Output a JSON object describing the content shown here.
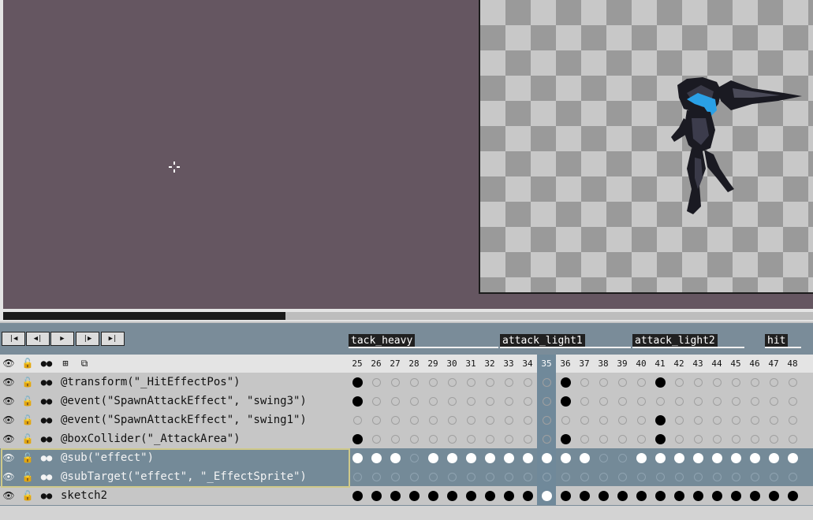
{
  "colors": {
    "canvas_bg": "#655661",
    "timeline_header": "#7a8c99",
    "row_light": "#c6c6c6",
    "row_header": "#e4e4e4",
    "row_selected": "#748a98",
    "row_selected_border": "#cfc98a",
    "current_frame_col": "#70899a",
    "cel_filled": "#000000",
    "cel_selected": "#ffffff"
  },
  "playback": {
    "buttons": [
      {
        "icon": "first-frame-icon",
        "glyph": "|◀"
      },
      {
        "icon": "previous-frame-icon",
        "glyph": "◀|"
      },
      {
        "icon": "play-icon",
        "glyph": "▶"
      },
      {
        "icon": "next-frame-icon",
        "glyph": "|▶"
      },
      {
        "icon": "last-frame-icon",
        "glyph": "▶|"
      }
    ]
  },
  "tags": [
    {
      "label": "tack_heavy",
      "from": 25,
      "to": 32
    },
    {
      "label": "attack_light1",
      "from": 33,
      "to": 39
    },
    {
      "label": "attack_light2",
      "from": 40,
      "to": 45
    },
    {
      "label": "hit",
      "from": 47,
      "to": 48
    }
  ],
  "layer_header": {
    "icons": [
      "eye-icon",
      "lock-icon",
      "continuous-icon",
      "layers-icon",
      "new-layer-icon"
    ]
  },
  "frames": [
    25,
    26,
    27,
    28,
    29,
    30,
    31,
    32,
    33,
    34,
    35,
    36,
    37,
    38,
    39,
    40,
    41,
    42,
    43,
    44,
    45,
    46,
    47,
    48
  ],
  "current_frame": 35,
  "layers": [
    {
      "name": "@transform(\"_HitEffectPos\")",
      "selected": false,
      "keys": [
        25,
        36,
        41
      ]
    },
    {
      "name": "@event(\"SpawnAttackEffect\", \"swing3\")",
      "selected": false,
      "keys": [
        25,
        36
      ]
    },
    {
      "name": "@event(\"SpawnAttackEffect\", \"swing1\")",
      "selected": false,
      "keys": [
        41
      ]
    },
    {
      "name": "@boxCollider(\"_AttackArea\")",
      "selected": false,
      "keys": [
        25,
        36,
        41
      ]
    },
    {
      "name": "@sub(\"effect\")",
      "selected": true,
      "keys": [
        25,
        26,
        27,
        29,
        30,
        31,
        32,
        33,
        34,
        35,
        36,
        37,
        40,
        41,
        42,
        43,
        44,
        45,
        46,
        47,
        48
      ]
    },
    {
      "name": "@subTarget(\"effect\", \"_EffectSprite\")",
      "selected": true,
      "keys": []
    },
    {
      "name": "sketch2",
      "selected": false,
      "keys": [
        25,
        26,
        27,
        28,
        29,
        30,
        31,
        32,
        33,
        34,
        35,
        36,
        37,
        38,
        39,
        40,
        41,
        42,
        43,
        44,
        45,
        46,
        47,
        48
      ]
    }
  ]
}
